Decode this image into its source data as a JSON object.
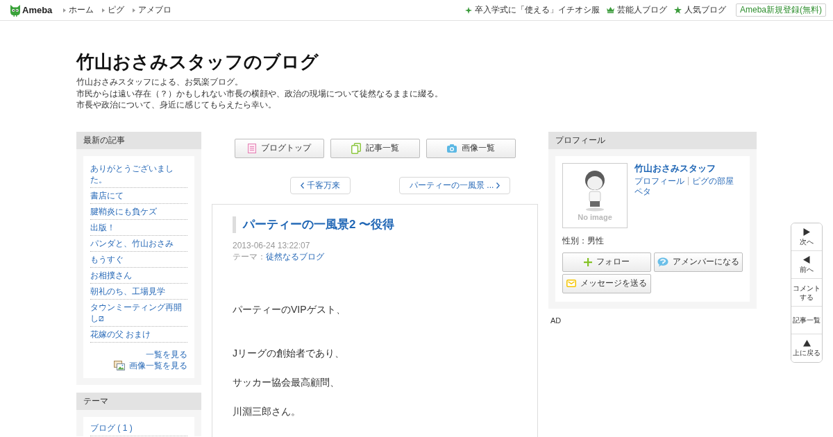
{
  "topbar": {
    "logo": "Ameba",
    "nav": [
      "ホーム",
      "ピグ",
      "アメブロ"
    ],
    "links": [
      {
        "kind": "sparkle",
        "label": "卒入学式に「使える」イチオシ服"
      },
      {
        "kind": "crown",
        "label": "芸能人ブログ"
      },
      {
        "kind": "star",
        "label": "人気ブログ"
      }
    ],
    "register_button": "Ameba新規登録(無料)"
  },
  "blog": {
    "title": "竹山おさみスタッフのブログ",
    "description": [
      "竹山おさみスタッフによる、お気楽ブログ。",
      "市民からは遠い存在（？）かもしれない市長の横顔や、政治の現場について徒然なるままに綴る。",
      "市長や政治について、身近に感じてもらえたら幸い。"
    ]
  },
  "recent_articles": {
    "heading": "最新の記事",
    "items": [
      "ありがとうございました。",
      "書店にて",
      "腱鞘炎にも負ケズ",
      "出版！",
      "パンダと、竹山おさみ",
      "もうすぐ",
      "お相撲さん",
      "朝礼のち、工場見学",
      "タウンミーティング再開し⧄",
      "花嫁の父 おまけ"
    ],
    "view_all": "一覧を見る",
    "image_list": "画像一覧を見る"
  },
  "themes": {
    "heading": "テーマ",
    "items": [
      "ブログ ( 1 )"
    ]
  },
  "blog_buttons": [
    {
      "kind": "top",
      "label": "ブログトップ"
    },
    {
      "kind": "articles",
      "label": "記事一覧"
    },
    {
      "kind": "images",
      "label": "画像一覧"
    }
  ],
  "pager": {
    "previous": "千客万来",
    "next": "パーティーの一風景 ..."
  },
  "article": {
    "title": "パーティーの一風景2 〜役得",
    "date": "2013-06-24 13:22:07",
    "theme_label": "テーマ：",
    "theme": "徒然なるブログ",
    "paragraphs": [
      "パーティーのVIPゲスト、",
      "Jリーグの創始者であり、",
      "サッカー協会最高顧問、",
      "川淵三郎さん。"
    ]
  },
  "profile": {
    "heading": "プロフィール",
    "avatar_caption": "No image",
    "name": "竹山おさみスタッフ",
    "links": [
      "プロフィール",
      "ピグの部屋"
    ],
    "extra_link": "ペタ",
    "gender": "性別：男性",
    "buttons": [
      {
        "kind": "follow",
        "label": "フォロー"
      },
      {
        "kind": "amember",
        "label": "アメンバーになる"
      },
      {
        "kind": "message",
        "label": "メッセージを送る"
      }
    ]
  },
  "ad_label": "AD",
  "side_nav": [
    {
      "kind": "next",
      "label": "次へ"
    },
    {
      "kind": "prev",
      "label": "前へ"
    },
    {
      "kind": "text",
      "label": "コメントする"
    },
    {
      "kind": "text",
      "label": "記事一覧"
    },
    {
      "kind": "top",
      "label": "上に戻る"
    }
  ]
}
